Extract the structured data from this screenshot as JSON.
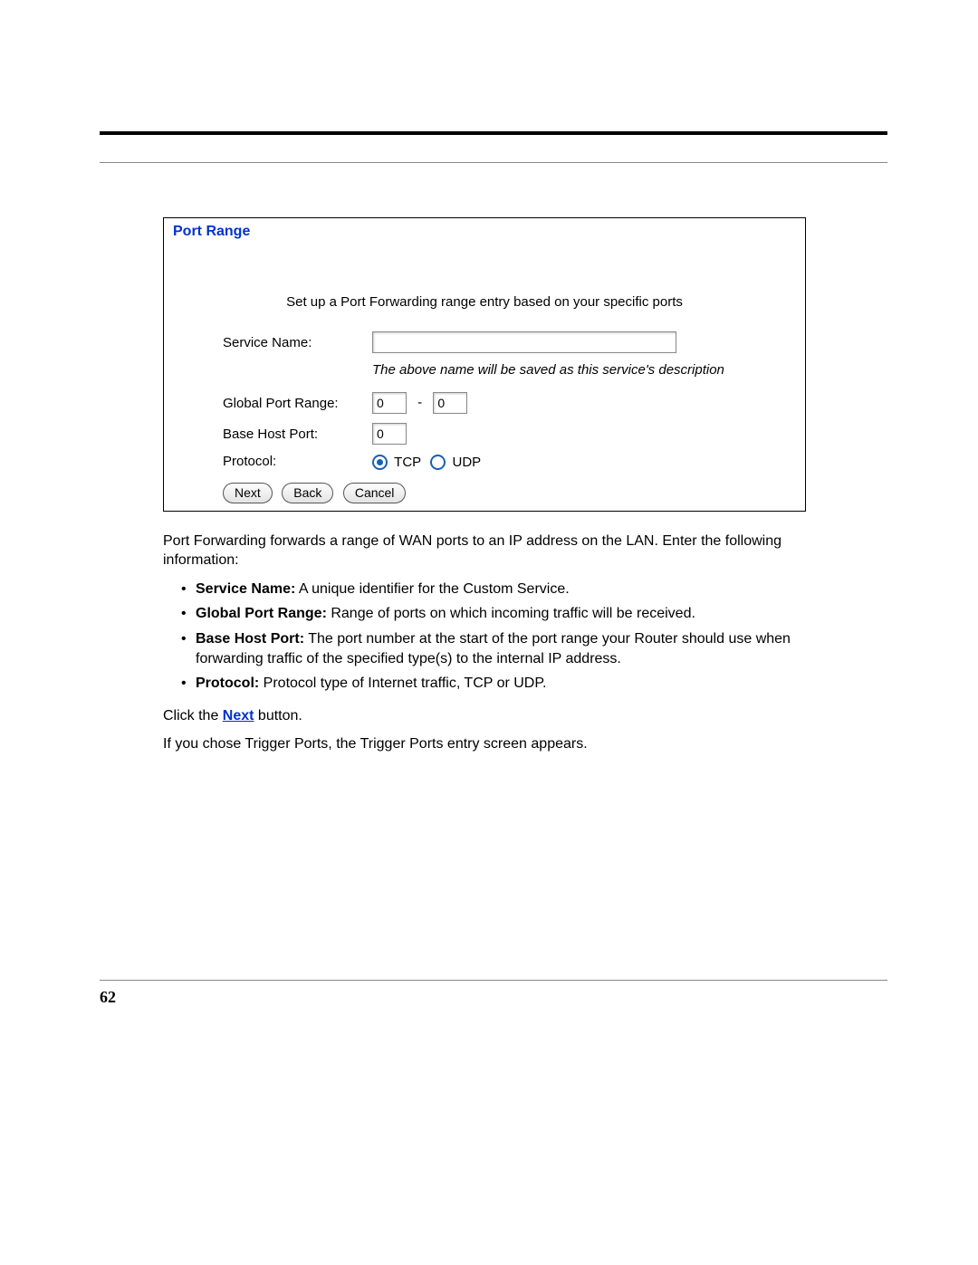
{
  "panel": {
    "title": "Port Range",
    "intro": "Set up a Port Forwarding range entry based on your specific ports",
    "labels": {
      "service_name": "Service Name:",
      "global_port_range": "Global Port Range:",
      "base_host_port": "Base Host Port:",
      "protocol": "Protocol:"
    },
    "values": {
      "service_name": "",
      "global_start": "0",
      "global_end": "0",
      "base_host_port": "0"
    },
    "note": "The above name will be saved as this service's description",
    "dash": "-",
    "protocol": {
      "tcp": "TCP",
      "udp": "UDP",
      "selected": "tcp"
    },
    "buttons": {
      "next": "Next",
      "back": "Back",
      "cancel": "Cancel"
    }
  },
  "body": {
    "para1": "Port Forwarding forwards a range of WAN ports to an IP address on the LAN. Enter the following information:",
    "bullets": [
      {
        "bold": "Service Name:",
        "text": " A unique identifier for the Custom Service."
      },
      {
        "bold": "Global Port Range:",
        "text": " Range of ports on which incoming traffic will be received."
      },
      {
        "bold": "Base Host Port:",
        "text": " The port number at the start of the port range your Router should use when forwarding traffic of the specified type(s) to the internal IP address."
      },
      {
        "bold": "Protocol:",
        "text": " Protocol type of Internet traffic, TCP or UDP."
      }
    ],
    "click_pre": "Click the ",
    "click_link": "Next",
    "click_post": " button.",
    "para2": "If you chose Trigger Ports, the Trigger Ports entry screen appears."
  },
  "page_number": "62"
}
